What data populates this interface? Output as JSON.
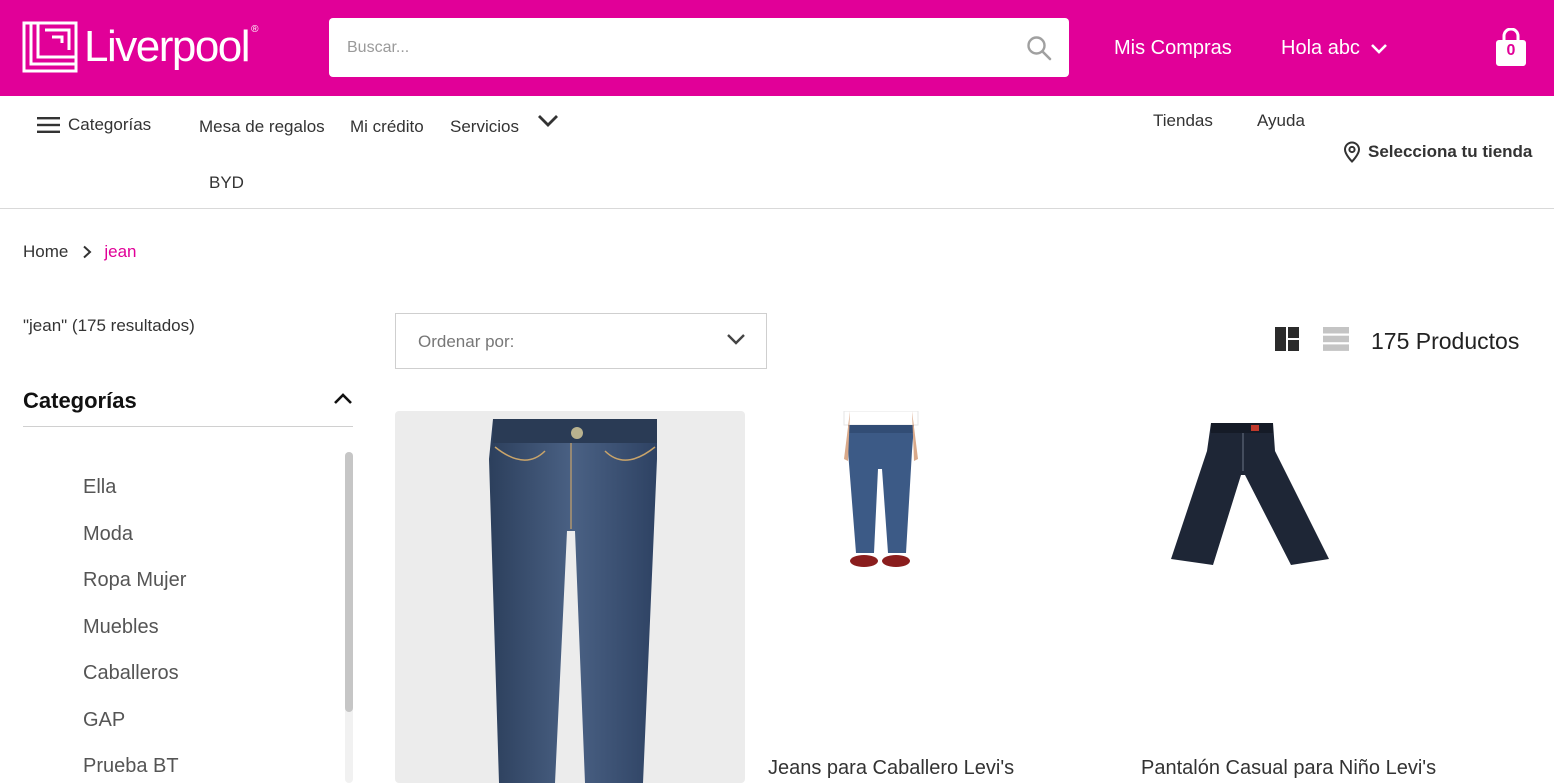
{
  "header": {
    "brand": "Liverpool",
    "brand_mark": "®",
    "search_placeholder": "Buscar...",
    "mis_compras": "Mis Compras",
    "greeting": "Hola abc",
    "cart_count": "0",
    "brand_color": "#e10098"
  },
  "nav": {
    "categories": "Categorías",
    "links": [
      "Mesa de regalos",
      "Mi crédito",
      "Servicios",
      "BYD"
    ],
    "tiendas": "Tiendas",
    "ayuda": "Ayuda",
    "store_select": "Selecciona tu tienda"
  },
  "breadcrumb": {
    "home": "Home",
    "current": "jean"
  },
  "sidebar": {
    "result_summary": "\"jean\" (175 resultados)",
    "categories_title": "Categorías",
    "categories": [
      "Ella",
      "Moda",
      "Ropa Mujer",
      "Muebles",
      "Caballeros",
      "GAP",
      "Prueba BT"
    ]
  },
  "toolbar": {
    "sort_label": "Ordenar por:",
    "count_number": "175",
    "count_label": "Productos"
  },
  "products": [
    {
      "title": "",
      "image": "dark-wash-skinny-jeans"
    },
    {
      "title": "Jeans para Caballero Levi's",
      "image": "man-wearing-straight-jeans"
    },
    {
      "title": "Pantalón Casual para Niño Levi's",
      "image": "kids-dark-bootcut-jeans"
    }
  ]
}
